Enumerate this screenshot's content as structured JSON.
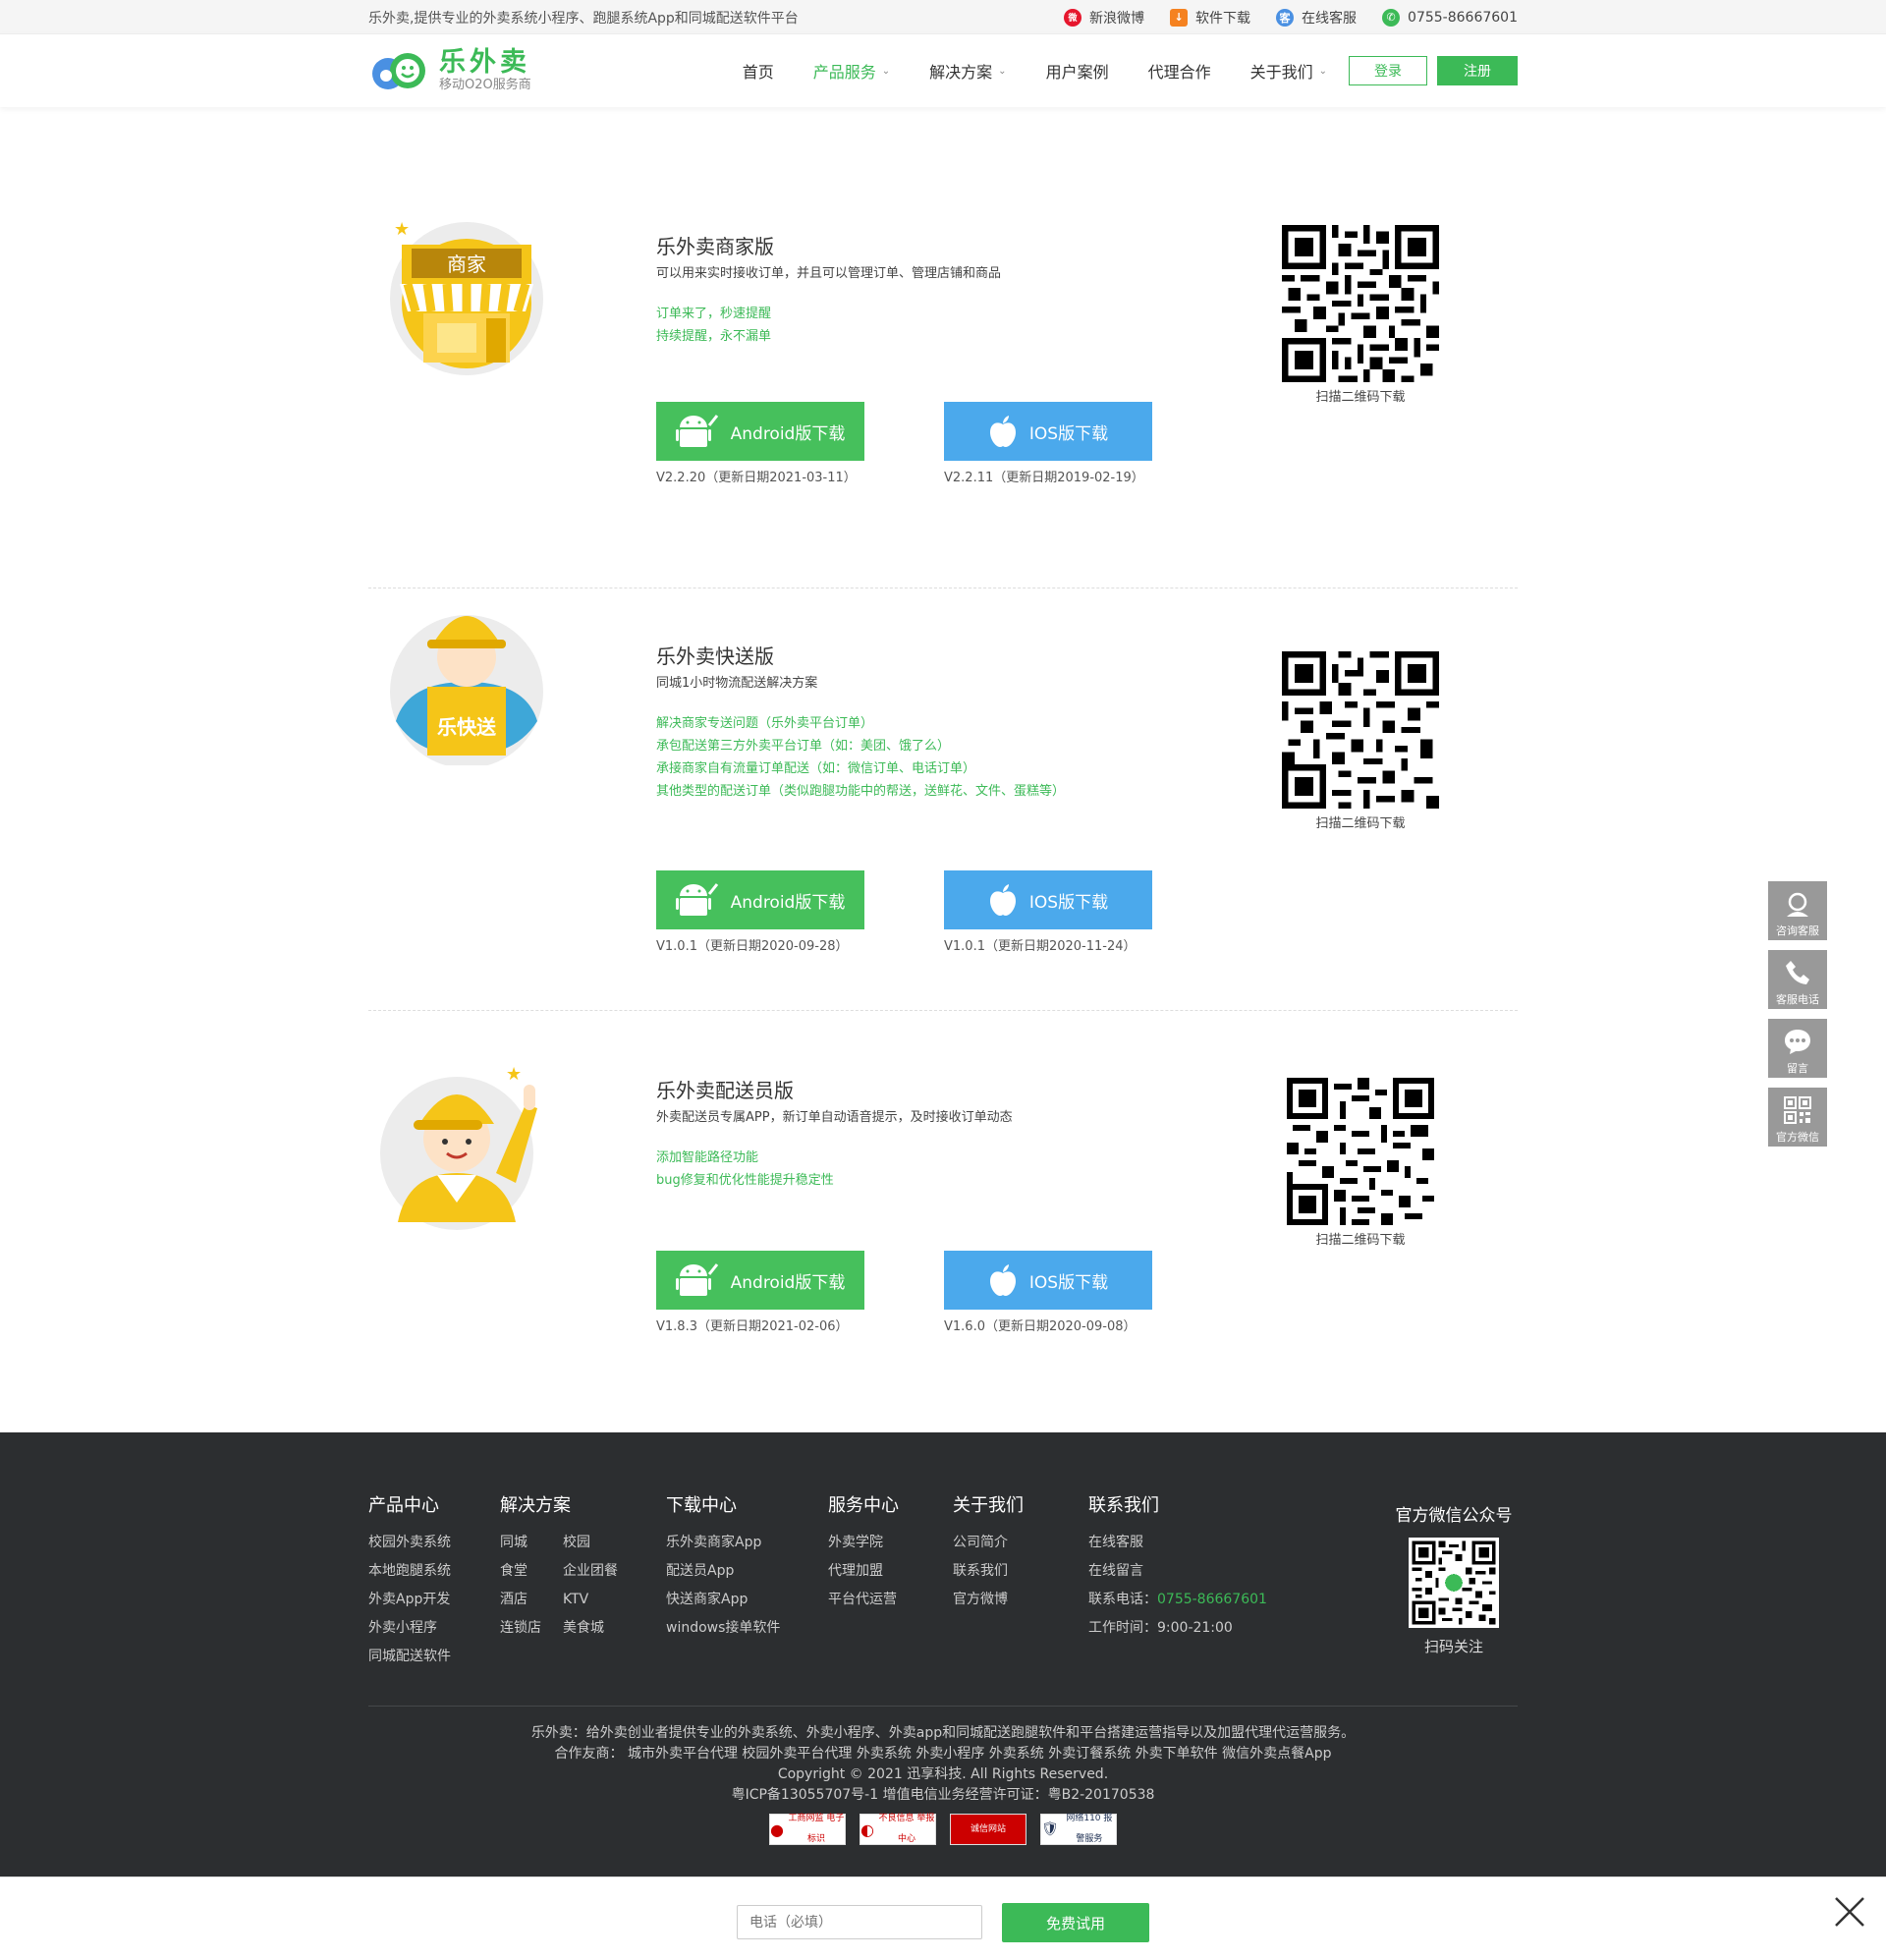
{
  "topbar": {
    "slogan": "乐外卖,提供专业的外卖系统小程序、跑腿系统App和同城配送软件平台",
    "links": [
      {
        "label": "新浪微博",
        "icon": "weibo-icon"
      },
      {
        "label": "软件下载",
        "icon": "download-icon"
      },
      {
        "label": "在线客服",
        "icon": "service-icon"
      },
      {
        "label": "0755-86667601",
        "icon": "phone-icon"
      }
    ]
  },
  "header": {
    "logo_title": "乐外卖",
    "logo_sub": "移动O2O服务商",
    "nav": [
      {
        "label": "首页"
      },
      {
        "label": "产品服务",
        "active": true,
        "dropdown": true
      },
      {
        "label": "解决方案",
        "dropdown": true
      },
      {
        "label": "用户案例"
      },
      {
        "label": "代理合作"
      },
      {
        "label": "关于我们",
        "dropdown": true
      }
    ],
    "login": "登录",
    "register": "注册"
  },
  "products": [
    {
      "title": "乐外卖商家版",
      "desc": "可以用来实时接收订单，并且可以管理订单、管理店铺和商品",
      "features": [
        "订单来了，秒速提醒",
        "持续提醒，永不漏单"
      ],
      "android_label": "Android版下载",
      "android_version": "V2.2.20（更新日期2021-03-11）",
      "ios_label": "IOS版下载",
      "ios_version": "V2.2.11（更新日期2019-02-19）",
      "qr_label": "扫描二维码下载",
      "image_text": "商家"
    },
    {
      "title": "乐外卖快送版",
      "desc": "同城1小时物流配送解决方案",
      "features": [
        "解决商家专送问题（乐外卖平台订单）",
        "承包配送第三方外卖平台订单（如：美团、饿了么）",
        "承接商家自有流量订单配送（如：微信订单、电话订单）",
        "其他类型的配送订单（类似跑腿功能中的帮送，送鲜花、文件、蛋糕等）"
      ],
      "android_label": "Android版下载",
      "android_version": "V1.0.1（更新日期2020-09-28）",
      "ios_label": "IOS版下载",
      "ios_version": "V1.0.1（更新日期2020-11-24）",
      "qr_label": "扫描二维码下载",
      "image_text": "乐快送"
    },
    {
      "title": "乐外卖配送员版",
      "desc": "外卖配送员专属APP，新订单自动语音提示，及时接收订单动态",
      "features": [
        "添加智能路径功能",
        "bug修复和优化性能提升稳定性"
      ],
      "android_label": "Android版下载",
      "android_version": "V1.8.3（更新日期2021-02-06）",
      "ios_label": "IOS版下载",
      "ios_version": "V1.6.0（更新日期2020-09-08）",
      "qr_label": "扫描二维码下载",
      "image_text": ""
    }
  ],
  "sidebar": [
    {
      "label": "咨询客服",
      "icon": "headset-icon"
    },
    {
      "label": "客服电话",
      "icon": "phone-icon"
    },
    {
      "label": "留言",
      "icon": "message-icon"
    },
    {
      "label": "官方微信",
      "icon": "qrcode-icon"
    }
  ],
  "footer": {
    "cols": {
      "product": {
        "title": "产品中心",
        "links": [
          "校园外卖系统",
          "本地跑腿系统",
          "外卖App开发",
          "外卖小程序",
          "同城配送软件"
        ]
      },
      "solution": {
        "title": "解决方案",
        "links": [
          "同城",
          "校园",
          "食堂",
          "企业团餐",
          "酒店",
          "KTV",
          "连锁店",
          "美食城"
        ]
      },
      "download": {
        "title": "下载中心",
        "links": [
          "乐外卖商家App",
          "配送员App",
          "快送商家App",
          "windows接单软件"
        ]
      },
      "service": {
        "title": "服务中心",
        "links": [
          "外卖学院",
          "代理加盟",
          "平台代运营"
        ]
      },
      "about": {
        "title": "关于我们",
        "links": [
          "公司简介",
          "联系我们",
          "官方微博"
        ]
      },
      "contact": {
        "title": "联系我们",
        "links": [
          "在线客服",
          "在线留言"
        ],
        "phone_label": "联系电话：",
        "phone": "0755-86667601",
        "hours": "工作时间：9:00-21:00"
      }
    },
    "wechat_title": "官方微信公众号",
    "wechat_sub": "扫码关注",
    "about_line": "乐外卖：给外卖创业者提供专业的外卖系统、外卖小程序、外卖app和同城配送跑腿软件和平台搭建运营指导以及加盟代理代运营服务。",
    "partners_line": "合作友商：  城市外卖平台代理   校园外卖平台代理   外卖系统  外卖小程序   外卖系统   外卖订餐系统   外卖下单软件   微信外卖点餐App",
    "copyright": "Copyright © 2021 迅享科技. All Rights Reserved.",
    "icp": "粤ICP备13055707号-1      增值电信业务经营许可证：粤B2-20170538",
    "badges": [
      "工商网监 电子标识",
      "不良信息 举报中心",
      "诚信网站",
      "网络110 报警服务"
    ]
  },
  "bottombar": {
    "placeholder": "电话（必填）",
    "button": "免费试用"
  },
  "colors": {
    "brand_green": "#3cba57",
    "ios_blue": "#4ba9ec",
    "footer_bg": "#2c2e30"
  }
}
